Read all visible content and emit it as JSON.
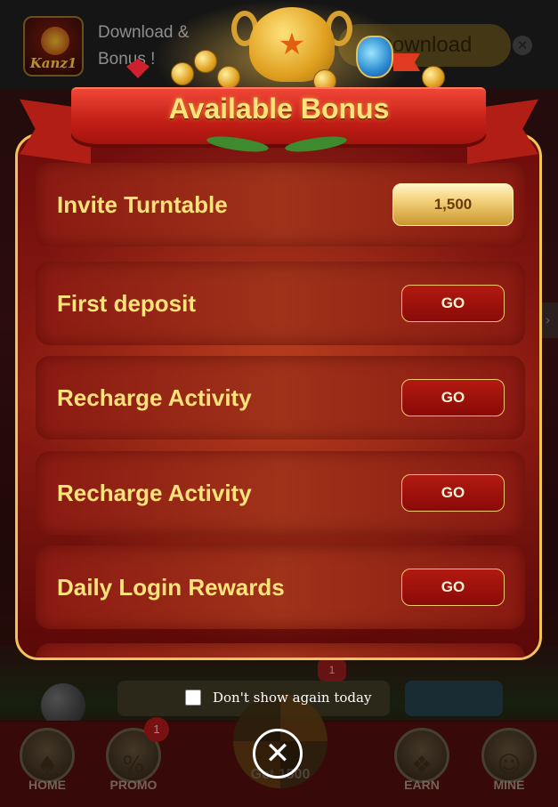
{
  "banner": {
    "logo_text": "Kanz1",
    "text_line1": "Download &",
    "text_line2": "Bonus !",
    "download_label": "Download",
    "close_glyph": "✕"
  },
  "modal": {
    "title": "Available Bonus",
    "rows": [
      {
        "label": "Invite Turntable",
        "action": "1,500",
        "kind": "amount"
      },
      {
        "label": "First deposit",
        "action": "GO",
        "kind": "button"
      },
      {
        "label": "Recharge Activity",
        "action": "GO",
        "kind": "button"
      },
      {
        "label": "Recharge Activity",
        "action": "GO",
        "kind": "button"
      },
      {
        "label": "Daily Login Rewards",
        "action": "GO",
        "kind": "button"
      }
    ],
    "dont_show_label": "Don't show again today",
    "dont_show_checked": false,
    "close_glyph": "✕"
  },
  "bottom_nav": {
    "items": [
      {
        "label": "HOME",
        "icon": "spade-icon",
        "glyph": "♠"
      },
      {
        "label": "PROMO",
        "icon": "percent-tag-icon",
        "glyph": "%"
      },
      {
        "label": "EARN",
        "icon": "gift-icon",
        "glyph": "❖"
      },
      {
        "label": "MINE",
        "icon": "smile-icon",
        "glyph": "☺"
      }
    ],
    "promo_badge": "1",
    "center_label": "Get 1500"
  },
  "background": {
    "badge_count": "1"
  },
  "colors": {
    "panel_border": "#f0c45a",
    "label_text": "#ffe27a",
    "ribbon": "#c21e16",
    "go_button": "#b21a10"
  }
}
